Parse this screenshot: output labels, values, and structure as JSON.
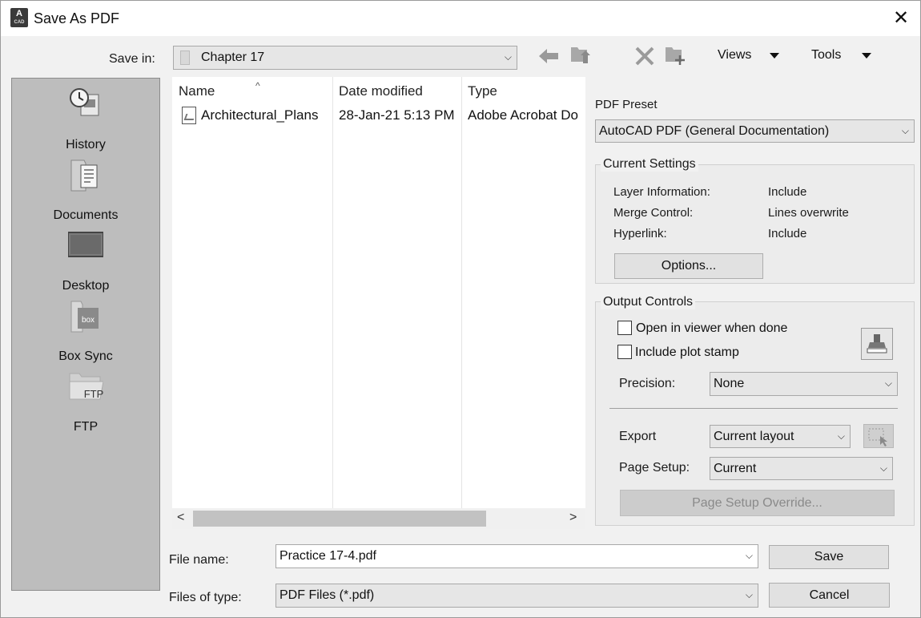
{
  "window": {
    "title": "Save As PDF",
    "app_icon_letter": "A"
  },
  "save_in": {
    "label": "Save in:",
    "value": "Chapter 17"
  },
  "toolbar": {
    "views_label": "Views",
    "tools_label": "Tools"
  },
  "places": [
    {
      "label": "History",
      "icon": "history-icon"
    },
    {
      "label": "Documents",
      "icon": "documents-icon"
    },
    {
      "label": "Desktop",
      "icon": "desktop-icon"
    },
    {
      "label": "Box Sync",
      "icon": "box-sync-icon",
      "icon_text": "box"
    },
    {
      "label": "FTP",
      "icon": "ftp-icon",
      "icon_text": "FTP"
    }
  ],
  "file_list": {
    "columns": [
      "Name",
      "Date modified",
      "Type"
    ],
    "rows": [
      {
        "name": "Architectural_Plans",
        "date": "28-Jan-21 5:13 PM",
        "type": "Adobe Acrobat Do"
      }
    ]
  },
  "pdf_preset": {
    "label": "PDF Preset",
    "value": "AutoCAD PDF (General Documentation)"
  },
  "current_settings": {
    "title": "Current Settings",
    "items": [
      {
        "key": "Layer Information:",
        "value": "Include"
      },
      {
        "key": "Merge Control:",
        "value": "Lines overwrite"
      },
      {
        "key": "Hyperlink:",
        "value": "Include"
      }
    ],
    "options_label": "Options..."
  },
  "output_controls": {
    "title": "Output Controls",
    "open_viewer_label": "Open in viewer when done",
    "open_viewer_checked": false,
    "plot_stamp_label": "Include plot stamp",
    "plot_stamp_checked": false,
    "precision_label": "Precision:",
    "precision_value": "None",
    "export_label": "Export",
    "export_value": "Current layout",
    "page_setup_label": "Page Setup:",
    "page_setup_value": "Current",
    "page_setup_override_label": "Page Setup Override..."
  },
  "file_name": {
    "label": "File name:",
    "value": "Practice 17-4.pdf"
  },
  "file_type": {
    "label": "Files of type:",
    "value": "PDF Files (*.pdf)"
  },
  "buttons": {
    "save": "Save",
    "cancel": "Cancel"
  }
}
